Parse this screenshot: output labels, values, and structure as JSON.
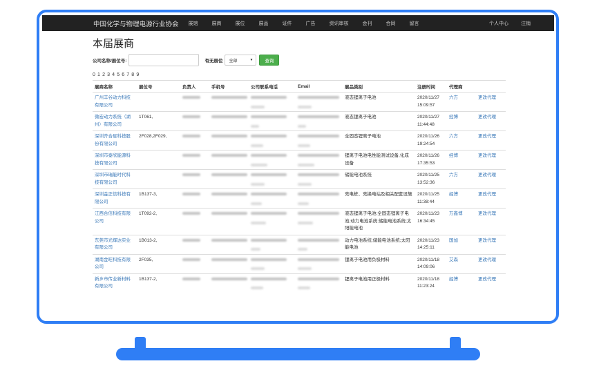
{
  "nav": {
    "brand": "中国化学与物理电源行业协会",
    "items": [
      "展馆",
      "展商",
      "展位",
      "展品",
      "证件",
      "广告",
      "资讯审核",
      "会刊",
      "合同",
      "留言"
    ],
    "right": [
      "个人中心",
      "注销"
    ]
  },
  "page": {
    "title": "本届展商",
    "search_label": "公司名称/展位号:",
    "search_value": "",
    "booth_label": "有无展位",
    "booth_select": "全部",
    "search_button": "查询",
    "pager": "0 1 2 3 4 5 6 7 8 9"
  },
  "table": {
    "headers": [
      "展商名称",
      "展位号",
      "负责人",
      "手机号",
      "公司联系电话",
      "Email",
      "展品类别",
      "注册时间",
      "代理商",
      ""
    ],
    "rows": [
      {
        "company": "广州丰谷动力科技有限公司",
        "booth": "",
        "category": "液态锂离子电池",
        "time": "2020/11/27 15:09:57",
        "agent": "六方",
        "action": "更改代理"
      },
      {
        "company": "微宏动力系统（湖州）有限公司",
        "booth": "1T061,",
        "category": "液态锂离子电池",
        "time": "2020/11/27 11:44:48",
        "agent": "经博",
        "action": "更改代理"
      },
      {
        "company": "深圳齐合星科技股份有限公司",
        "booth": "2F028,2F029,",
        "category": "全固态锂离子电池",
        "time": "2020/11/26 19:24:54",
        "agent": "六方",
        "action": "更改代理"
      },
      {
        "company": "深圳市泰欣能源科技有限公司",
        "booth": "",
        "category": "锂离子电池电性能测试设备,化成设备",
        "time": "2020/11/26 17:35:53",
        "agent": "经博",
        "action": "更改代理"
      },
      {
        "company": "深圳市瑞能时代科技有限公司",
        "booth": "",
        "category": "储能电池系统",
        "time": "2020/11/25 13:52:36",
        "agent": "六方",
        "action": "更改代理"
      },
      {
        "company": "深圳金正信科技有限公司",
        "booth": "1B137-3,",
        "category": "充电桩、充换电站及相关配套设施",
        "time": "2020/11/25 11:38:44",
        "agent": "经博",
        "action": "更改代理"
      },
      {
        "company": "江西合信科技有限公司",
        "booth": "1T092-2,",
        "category": "液态锂离子电池;全固态锂离子电池;动力电池系统;储能电池系统;太阳能电池",
        "time": "2020/11/23 16:34:45",
        "agent": "万鑫博",
        "action": "更改代理"
      },
      {
        "company": "东莞市光辉达实业有限公司",
        "booth": "1B013-2,",
        "category": "动力电池系统;储能电池系统;太阳能电池",
        "time": "2020/11/23 14:25:11",
        "agent": "国加",
        "action": "更改代理"
      },
      {
        "company": "湖南金旺科技有限公司",
        "booth": "2F035,",
        "category": "锂离子电池用负极材料",
        "time": "2020/11/18 14:09:06",
        "agent": "艾森",
        "action": "更改代理"
      },
      {
        "company": "新乡市传业新材料有限公司",
        "booth": "1B137-2,",
        "category": "锂离子电池用正极材料",
        "time": "2020/11/18 11:23:24",
        "agent": "经博",
        "action": "更改代理"
      }
    ]
  },
  "colors": {
    "frame": "#2f7ef5",
    "navbar": "#222222",
    "link": "#3a78b8",
    "button": "#4cae4c"
  }
}
